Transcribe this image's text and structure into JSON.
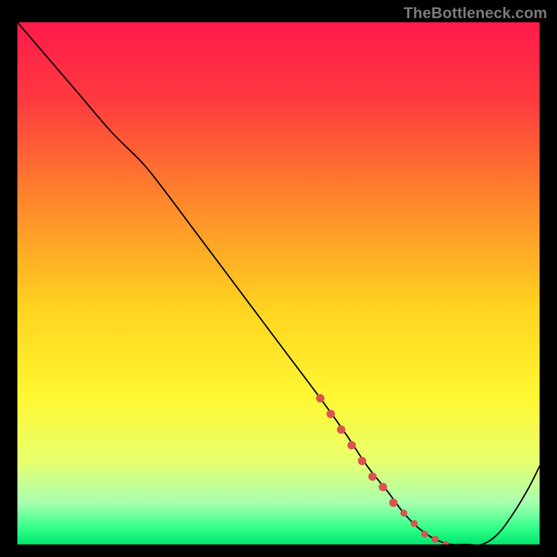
{
  "watermark": "TheBottleneck.com",
  "chart_data": {
    "type": "line",
    "title": "",
    "xlabel": "",
    "ylabel": "",
    "xlim": [
      0,
      100
    ],
    "ylim": [
      0,
      100
    ],
    "grid": false,
    "legend": false,
    "background_gradient": {
      "stops": [
        {
          "offset": 0.0,
          "color": "#ff1a4b"
        },
        {
          "offset": 0.15,
          "color": "#ff3a3f"
        },
        {
          "offset": 0.35,
          "color": "#ff8a2a"
        },
        {
          "offset": 0.55,
          "color": "#ffd41f"
        },
        {
          "offset": 0.72,
          "color": "#fff833"
        },
        {
          "offset": 0.84,
          "color": "#e8ff6e"
        },
        {
          "offset": 0.92,
          "color": "#a8ffb0"
        },
        {
          "offset": 0.97,
          "color": "#2fff8a"
        },
        {
          "offset": 1.0,
          "color": "#00e56a"
        }
      ]
    },
    "series": [
      {
        "name": "bottleneck-curve",
        "color": "#000000",
        "stroke_width": 2,
        "x": [
          0,
          6,
          12,
          18,
          24,
          28,
          34,
          40,
          46,
          52,
          58,
          63,
          67,
          71,
          74,
          77,
          80,
          83,
          86,
          89,
          92,
          95,
          98,
          100
        ],
        "y": [
          100,
          93,
          86,
          79,
          73,
          68,
          60,
          52,
          44,
          36,
          28,
          21,
          15,
          10,
          6,
          3,
          1,
          0,
          0,
          0,
          2,
          6,
          11,
          15
        ]
      }
    ],
    "markers": {
      "name": "highlight-dots",
      "color": "#d9534f",
      "radius_thick": 6,
      "radius_dot": 5,
      "points": [
        {
          "x": 58,
          "y": 28,
          "r": 6
        },
        {
          "x": 60,
          "y": 25,
          "r": 6
        },
        {
          "x": 62,
          "y": 22,
          "r": 6
        },
        {
          "x": 64,
          "y": 19,
          "r": 6
        },
        {
          "x": 66,
          "y": 16,
          "r": 6
        },
        {
          "x": 68,
          "y": 13,
          "r": 6
        },
        {
          "x": 70,
          "y": 11,
          "r": 6
        },
        {
          "x": 72,
          "y": 8,
          "r": 6
        },
        {
          "x": 74,
          "y": 6,
          "r": 5
        },
        {
          "x": 76,
          "y": 4,
          "r": 5
        },
        {
          "x": 78,
          "y": 2,
          "r": 5
        },
        {
          "x": 80,
          "y": 1,
          "r": 5
        },
        {
          "x": 82,
          "y": 0,
          "r": 5
        }
      ]
    }
  }
}
